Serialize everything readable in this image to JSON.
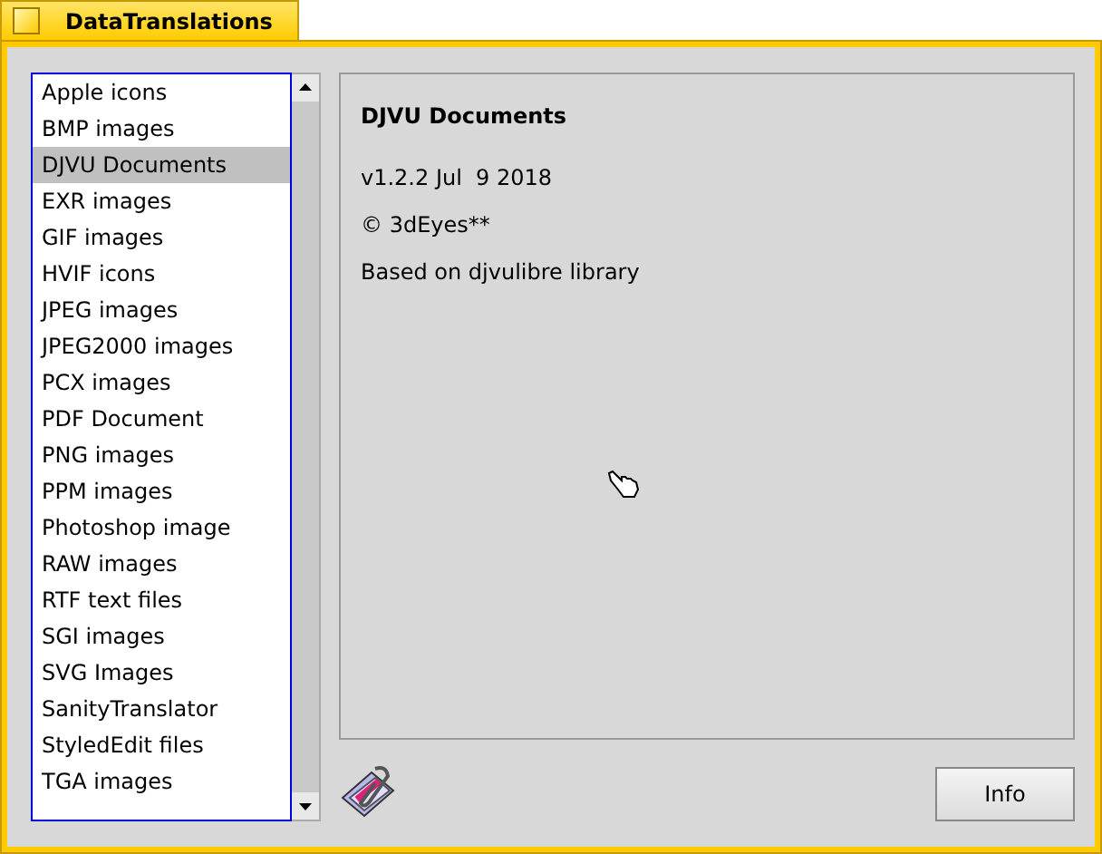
{
  "window": {
    "title": "DataTranslations"
  },
  "translators": [
    {
      "label": "Apple icons",
      "selected": false
    },
    {
      "label": "BMP images",
      "selected": false
    },
    {
      "label": "DJVU Documents",
      "selected": true
    },
    {
      "label": "EXR images",
      "selected": false
    },
    {
      "label": "GIF images",
      "selected": false
    },
    {
      "label": "HVIF icons",
      "selected": false
    },
    {
      "label": "JPEG images",
      "selected": false
    },
    {
      "label": "JPEG2000 images",
      "selected": false
    },
    {
      "label": "PCX images",
      "selected": false
    },
    {
      "label": "PDF Document",
      "selected": false
    },
    {
      "label": "PNG images",
      "selected": false
    },
    {
      "label": "PPM images",
      "selected": false
    },
    {
      "label": "Photoshop image",
      "selected": false
    },
    {
      "label": "RAW images",
      "selected": false
    },
    {
      "label": "RTF text files",
      "selected": false
    },
    {
      "label": "SGI images",
      "selected": false
    },
    {
      "label": "SVG Images",
      "selected": false
    },
    {
      "label": "SanityTranslator",
      "selected": false
    },
    {
      "label": "StyledEdit files",
      "selected": false
    },
    {
      "label": "TGA images",
      "selected": false
    }
  ],
  "details": {
    "title": "DJVU Documents",
    "lines": [
      "v1.2.2 Jul  9 2018",
      "© 3dEyes**",
      "Based on djvulibre library"
    ]
  },
  "info_button": "Info"
}
